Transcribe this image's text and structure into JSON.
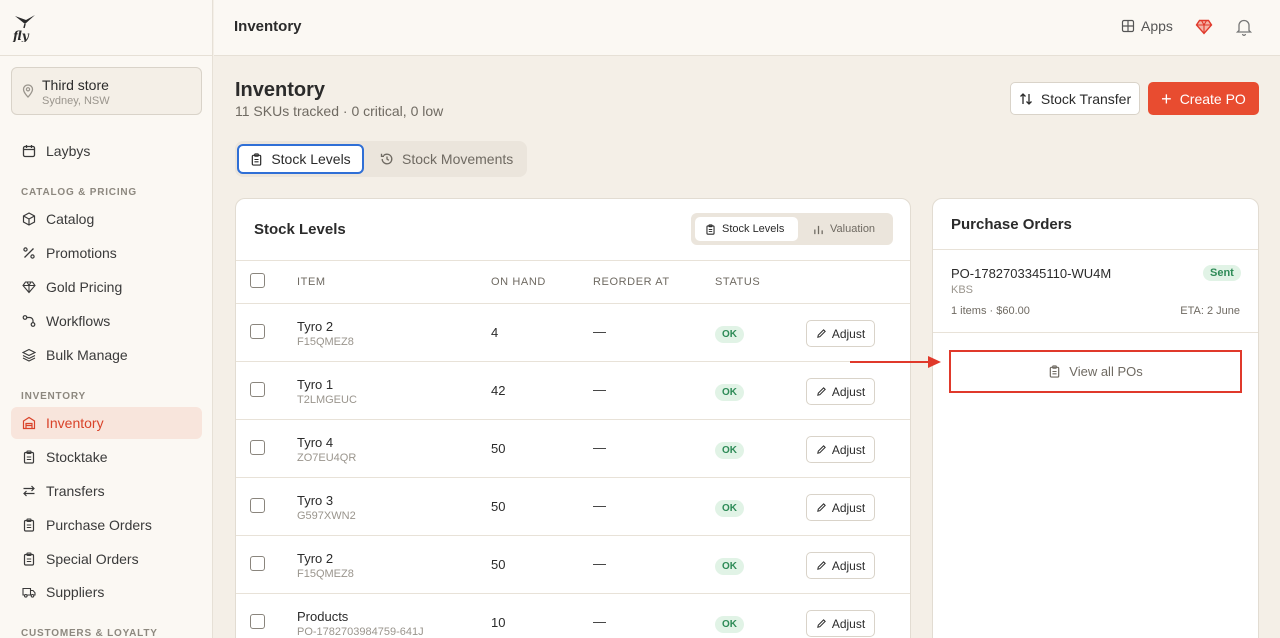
{
  "app": {
    "logo_text": "fly"
  },
  "sidebar": {
    "store": {
      "name": "Third store",
      "location": "Sydney, NSW"
    },
    "items_top": [
      {
        "label": "Laybys",
        "icon": "calendar-icon"
      }
    ],
    "sections": [
      {
        "title": "CATALOG & PRICING",
        "items": [
          {
            "label": "Catalog",
            "icon": "package-icon"
          },
          {
            "label": "Promotions",
            "icon": "percent-icon"
          },
          {
            "label": "Gold Pricing",
            "icon": "gem-icon"
          },
          {
            "label": "Workflows",
            "icon": "workflow-icon"
          },
          {
            "label": "Bulk Manage",
            "icon": "layers-icon"
          }
        ]
      },
      {
        "title": "INVENTORY",
        "items": [
          {
            "label": "Inventory",
            "icon": "warehouse-icon",
            "active": true
          },
          {
            "label": "Stocktake",
            "icon": "clipboard-icon"
          },
          {
            "label": "Transfers",
            "icon": "transfer-icon"
          },
          {
            "label": "Purchase Orders",
            "icon": "clipboard-icon"
          },
          {
            "label": "Special Orders",
            "icon": "clipboard-icon"
          },
          {
            "label": "Suppliers",
            "icon": "truck-icon"
          }
        ]
      },
      {
        "title": "CUSTOMERS & LOYALTY",
        "items": []
      }
    ]
  },
  "topbar": {
    "title": "Inventory",
    "apps_label": "Apps"
  },
  "header": {
    "title": "Inventory",
    "subtitle": "11 SKUs tracked · 0 critical, 0 low",
    "stock_transfer_label": "Stock Transfer",
    "create_po_label": "Create PO"
  },
  "tabs": [
    {
      "label": "Stock Levels",
      "active": true
    },
    {
      "label": "Stock Movements",
      "active": false
    }
  ],
  "stock_card": {
    "title": "Stock Levels",
    "segments": [
      {
        "label": "Stock Levels",
        "active": true
      },
      {
        "label": "Valuation",
        "active": false
      }
    ],
    "columns": [
      "ITEM",
      "ON HAND",
      "REORDER AT",
      "STATUS"
    ],
    "adjust_label": "Adjust",
    "rows": [
      {
        "name": "Tyro 2",
        "sku": "F15QMEZ8",
        "on_hand": "4",
        "reorder": "—",
        "status": "OK"
      },
      {
        "name": "Tyro 1",
        "sku": "T2LMGEUC",
        "on_hand": "42",
        "reorder": "—",
        "status": "OK"
      },
      {
        "name": "Tyro 4",
        "sku": "ZO7EU4QR",
        "on_hand": "50",
        "reorder": "—",
        "status": "OK"
      },
      {
        "name": "Tyro 3",
        "sku": "G597XWN2",
        "on_hand": "50",
        "reorder": "—",
        "status": "OK"
      },
      {
        "name": "Tyro 2",
        "sku": "F15QMEZ8",
        "on_hand": "50",
        "reorder": "—",
        "status": "OK"
      },
      {
        "name": "Products",
        "sku": "PO-1782703984759-641J",
        "on_hand": "10",
        "reorder": "—",
        "status": "OK"
      }
    ]
  },
  "po_card": {
    "title": "Purchase Orders",
    "order": {
      "number": "PO-1782703345110-WU4M",
      "status": "Sent",
      "supplier": "KBS",
      "meta": "1 items · $60.00",
      "eta": "ETA: 2 June"
    },
    "view_all_label": "View all POs"
  },
  "colors": {
    "accent": "#e84c30",
    "active_tab_border": "#2f6fd6",
    "ok_green": "#2e8b57",
    "highlight_red": "#e0392b"
  }
}
